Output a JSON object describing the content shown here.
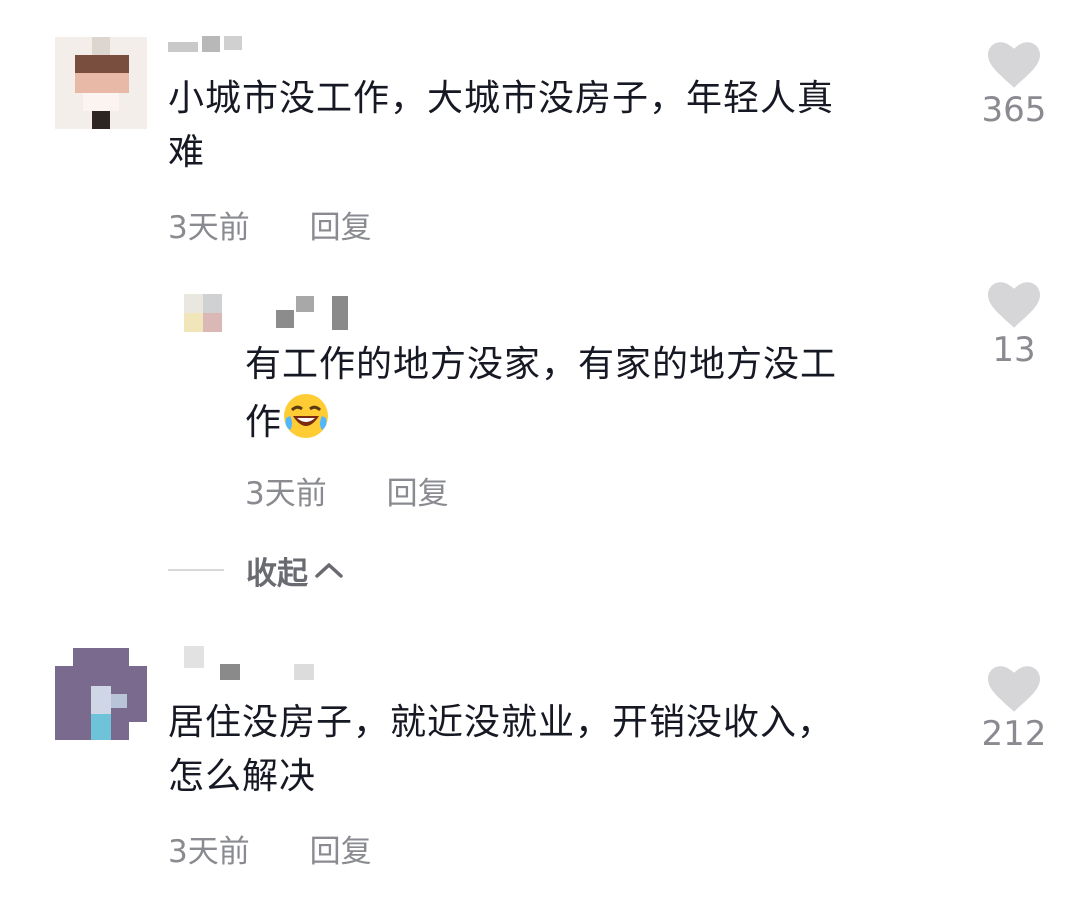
{
  "comments": [
    {
      "text_line1": "小城市没工作，大城市没房子，年轻人真",
      "text_line2": "难",
      "time": "3天前",
      "reply": "回复",
      "likes": "365"
    },
    {
      "text_line1": "有工作的地方没家，有家的地方没工",
      "text_line2": "作",
      "time": "3天前",
      "reply": "回复",
      "likes": "13"
    },
    {
      "text_line1": "居住没房子，就近没就业，开销没收入，",
      "text_line2": "怎么解决",
      "time": "3天前",
      "reply": "回复",
      "likes": "212"
    }
  ],
  "collapse_label": "收起",
  "icons": {
    "like": "heart-icon",
    "collapse": "chevron-up-icon",
    "emoji": "laughing-crying-emoji"
  },
  "colors": {
    "text": "#161823",
    "meta": "#8a8b91",
    "heart": "#d6d6d8"
  }
}
